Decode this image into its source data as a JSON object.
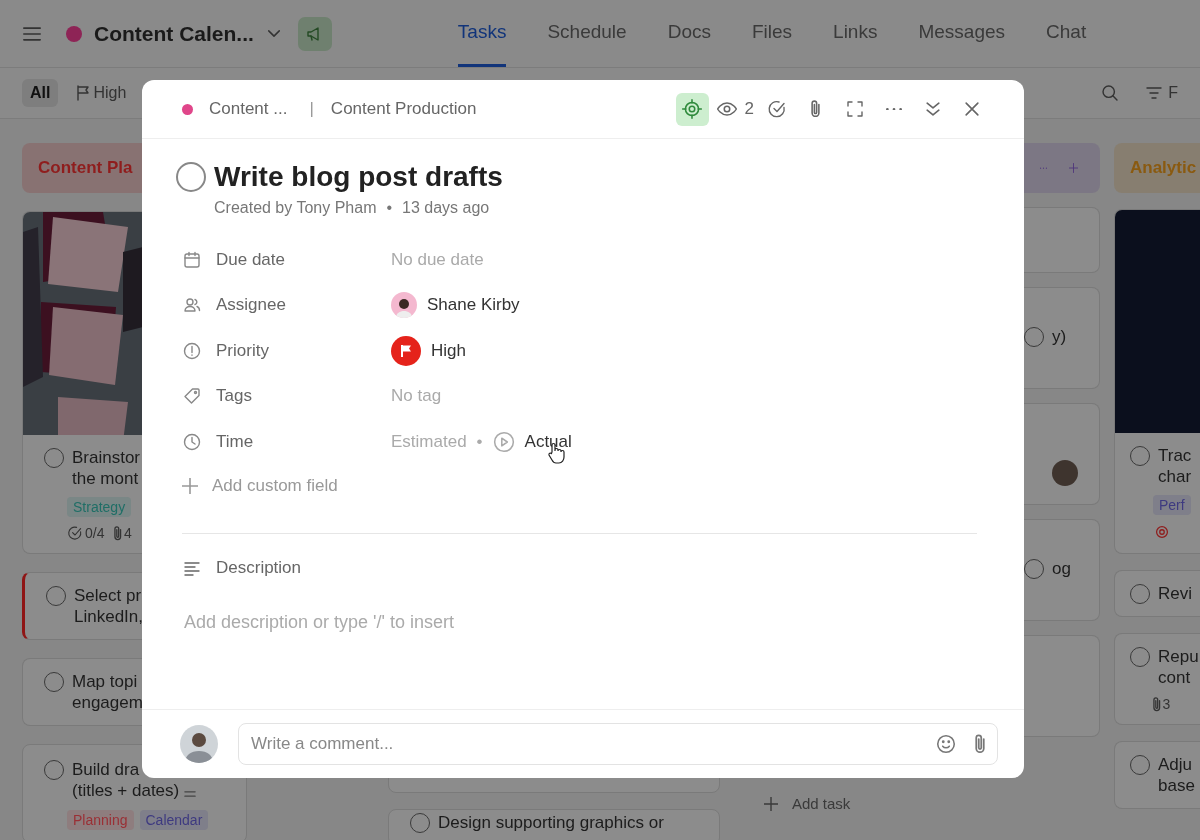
{
  "topbar": {
    "space": {
      "name": "Content Calen...",
      "color": "#8e2456"
    },
    "tabs": [
      {
        "label": "Tasks",
        "selected": true
      },
      {
        "label": "Schedule",
        "selected": false
      },
      {
        "label": "Docs",
        "selected": false
      },
      {
        "label": "Files",
        "selected": false
      },
      {
        "label": "Links",
        "selected": false
      },
      {
        "label": "Messages",
        "selected": false
      },
      {
        "label": "Chat",
        "selected": false
      }
    ]
  },
  "filterbar": {
    "chips": [
      {
        "label": "All",
        "selected": true
      },
      {
        "label": "High",
        "selected": false
      }
    ],
    "filter_label": "F"
  },
  "board": {
    "columns": [
      {
        "title": "Content Pla",
        "color": "#8f1d1d",
        "cards": [
          {
            "kind": "picture",
            "lines": [
              "Brainstor",
              "the mont"
            ],
            "done": false,
            "flagged": false,
            "tags": [
              {
                "label": "Strategy",
                "color": "#1f6e66"
              }
            ],
            "subtasks": "0/4",
            "attachments": "4"
          },
          {
            "kind": "task",
            "lines": [
              "Select pr",
              "LinkedIn,"
            ],
            "done": false,
            "flagged": true
          },
          {
            "kind": "task",
            "lines": [
              "Map topi",
              "engagem"
            ],
            "done": false,
            "flagged": false
          },
          {
            "kind": "task",
            "lines": [
              "Build dra",
              "(titles + dates)"
            ],
            "done": false,
            "flagged": false,
            "tags": [
              {
                "label": "Planning",
                "color": "#9a2f35"
              },
              {
                "label": "Calendar",
                "color": "#3e3a80"
              }
            ]
          }
        ]
      },
      {
        "kind": "hidden",
        "cards": [
          {
            "kind": "task"
          },
          {
            "kind": "task",
            "lines": [
              "Design supporting graphics or"
            ],
            "done": false
          }
        ]
      },
      {
        "kind": "strip",
        "color": "#4f357c",
        "cards": [
          {
            "kind": "task"
          },
          {
            "kind": "task",
            "lines": [
              "y)"
            ],
            "done": false
          },
          {
            "kind": "avatar"
          },
          {
            "kind": "task",
            "lines": [
              "og"
            ],
            "done": false
          },
          {
            "kind": "task"
          }
        ],
        "add_task": "Add task"
      },
      {
        "title": "Analytic",
        "color": "#8a5a10",
        "cards": [
          {
            "kind": "picture",
            "lines": [
              "Trac",
              "char"
            ],
            "done": false,
            "flagged": false,
            "tags": [
              {
                "label": "Perf",
                "color": "#3e3a80"
              }
            ],
            "goal": true
          },
          {
            "kind": "task",
            "lines": [
              "Revi"
            ],
            "done": false,
            "flagged": false
          },
          {
            "kind": "task",
            "lines": [
              "Repu",
              "cont"
            ],
            "done": false,
            "flagged": false,
            "attachments": "3"
          },
          {
            "kind": "task",
            "lines": [
              "Adju",
              "base"
            ],
            "done": false,
            "flagged": false
          }
        ]
      }
    ]
  },
  "task": {
    "breadcrumb": {
      "list": "Content ...",
      "color": "#e0468a",
      "separator": "|",
      "section": "Content Production"
    },
    "tools": [
      {
        "kind": "goal",
        "active": true
      },
      {
        "kind": "watchers",
        "count": "2",
        "active": false
      },
      {
        "kind": "check",
        "active": false
      },
      {
        "kind": "attach",
        "active": false
      },
      {
        "kind": "expand",
        "active": false
      },
      {
        "kind": "more",
        "active": false
      },
      {
        "kind": "collapse",
        "active": false
      },
      {
        "kind": "close",
        "active": false
      }
    ],
    "completed": false,
    "title": "Write blog post drafts",
    "creator": "Created by Tony Pham",
    "separator": "•",
    "age": "13 days ago",
    "fields": [
      {
        "kind": "date",
        "label": "Due date",
        "placeholder": "No due date"
      },
      {
        "kind": "person",
        "label": "Assignee",
        "value": "Shane Kirby"
      },
      {
        "kind": "priority",
        "label": "Priority",
        "value": "High",
        "color": "#e5231b"
      },
      {
        "kind": "tags",
        "label": "Tags",
        "placeholder": "No tag"
      },
      {
        "kind": "time",
        "label": "Time",
        "placeholder": "Estimated",
        "separator": "•",
        "actual": "Actual"
      }
    ],
    "add_field": "Add custom field",
    "description": {
      "label": "Description",
      "placeholder": "Add description or type '/' to insert"
    },
    "comment": {
      "placeholder": "Write a comment..."
    }
  }
}
